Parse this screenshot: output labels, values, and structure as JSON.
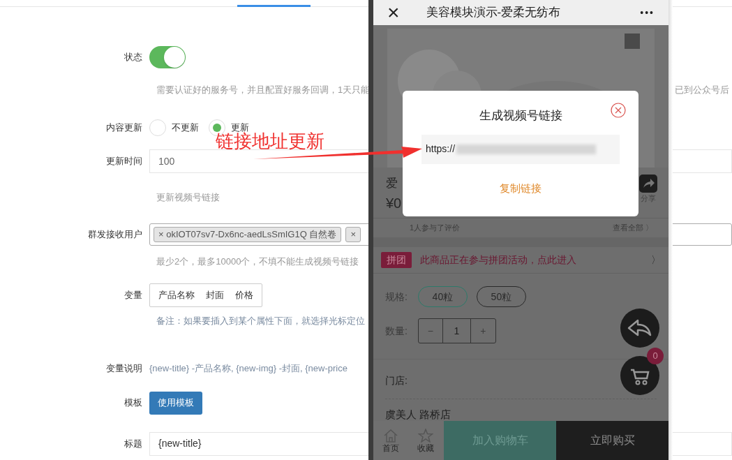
{
  "form": {
    "status": {
      "label": "状态",
      "on": true,
      "hint": "需要认证好的服务号，并且配置好服务回调，1天只能",
      "hint_right": "已到公众号后"
    },
    "content_update": {
      "label": "内容更新",
      "options": [
        {
          "label": "不更新",
          "selected": false
        },
        {
          "label": "更新",
          "selected": true
        }
      ]
    },
    "update_time": {
      "label": "更新时间",
      "value": "100",
      "hint": "更新视频号链接"
    },
    "recipients": {
      "label": "群发接收用户",
      "tags": [
        "× okIOT07sv7-Dx6nc-aedLsSmIG1Q 自然卷",
        "×"
      ],
      "hint": "最少2个，最多10000个，不填不能生成视频号链接"
    },
    "variables": {
      "label": "变量",
      "items": [
        "产品名称",
        "封面",
        "价格"
      ],
      "note": "备注：如果要插入到某个属性下面，就选择光标定位"
    },
    "variable_desc": {
      "label": "变量说明",
      "text": "{new-title} -产品名称, {new-img} -封面, {new-price"
    },
    "template": {
      "label": "模板",
      "button": "使用模板"
    },
    "title": {
      "label": "标题",
      "value": "{new-title}"
    }
  },
  "annotation": {
    "text": "链接地址更新"
  },
  "phone": {
    "close": "×",
    "title": "美容模块演示-爱柔无纺布",
    "more": "•••",
    "product_name": "爱",
    "price": "¥0",
    "share": "分享",
    "reviews": "1人参与了评价",
    "view_all": "查看全部 〉",
    "group_badge": "拼团",
    "group_text": "此商品正在参与拼团活动，点此进入",
    "group_arrow": "〉",
    "spec_label": "规格:",
    "specs": [
      {
        "label": "40粒",
        "selected": true
      },
      {
        "label": "50粒",
        "selected": false
      }
    ],
    "qty_label": "数量:",
    "minus": "−",
    "qty": "1",
    "plus": "+",
    "store_label": "门店:",
    "store": "虞美人 路桥店",
    "cart_count": "0",
    "nav": [
      {
        "label": "首页",
        "kind": "home"
      },
      {
        "label": "收藏",
        "kind": "star"
      }
    ],
    "add_cart": "加入购物车",
    "buy_now": "立即购买",
    "modal": {
      "title": "生成视频号链接",
      "url": "https://",
      "copy": "复制链接"
    }
  }
}
